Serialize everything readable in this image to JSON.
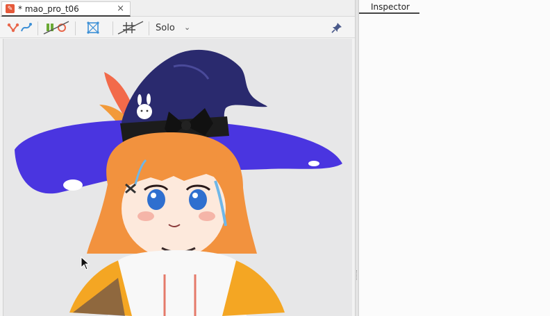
{
  "window": {
    "tab": {
      "title": "* mao_pro_t06",
      "icon": "live2d-model-icon",
      "close_glyph": "×"
    },
    "toolbar": {
      "tools": [
        {
          "name": "deformer-path-tool",
          "icon": "deformer-path-icon"
        },
        {
          "name": "glue-tool",
          "icon": "glue-icon"
        },
        {
          "name": "mesh-edit-tool",
          "icon": "mesh-edit-icon"
        },
        {
          "name": "grid-toggle",
          "icon": "grid-off-icon"
        }
      ],
      "solo_label": "Solo",
      "solo_chevron": "⌄",
      "pin_icon": "pin-icon"
    },
    "canvas": {
      "subject": "witch-character-model"
    }
  },
  "inspector": {
    "tab_label": "Inspector"
  },
  "colors": {
    "hat_brim": "#4a35e0",
    "hat_crown": "#2a2a6e",
    "hair": "#f2923e",
    "jacket": "#f4a623",
    "accent_tab": "#e5593a"
  }
}
